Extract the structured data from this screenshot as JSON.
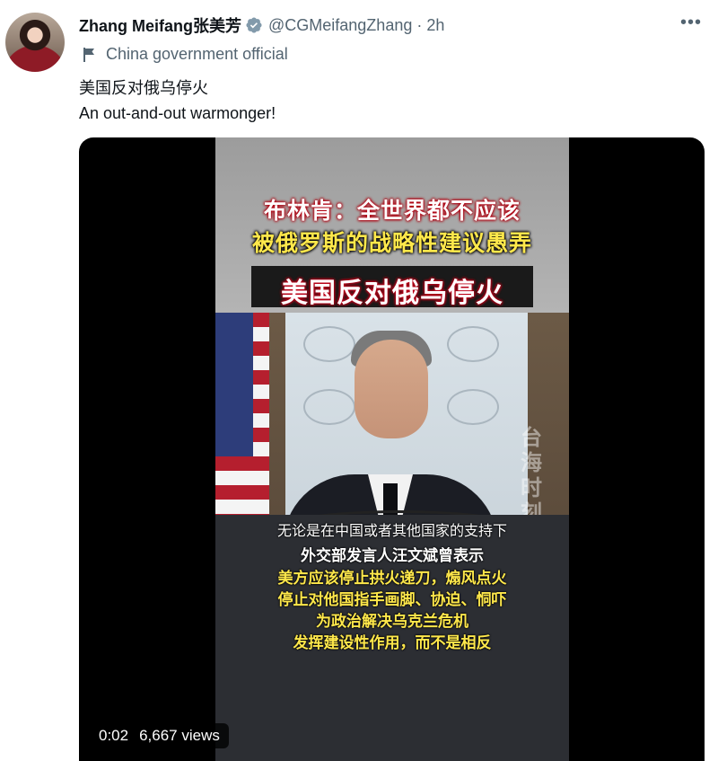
{
  "author": {
    "name": "Zhang Meifang张美芳",
    "handle": "@CGMeifangZhang",
    "separator": "·",
    "time": "2h",
    "label": "China government official"
  },
  "tweet": {
    "line1": "美国反对俄乌停火",
    "line2": "An out-and-out warmonger!"
  },
  "video": {
    "caption_top": "布林肯：全世界都不应该",
    "caption_mid": "被俄罗斯的战略性建议愚弄",
    "caption_headline": "美国反对俄乌停火",
    "watermark": "台海时刻",
    "subtitles": [
      "无论是在中国或者其他国家的支持下",
      "外交部发言人汪文斌曾表示",
      "美方应该停止拱火递刀，煽风点火",
      "停止对他国指手画脚、协迫、恫吓",
      "为政治解决乌克兰危机",
      "发挥建设性作用，而不是相反"
    ],
    "elapsed": "0:02",
    "views": "6,667 views"
  },
  "colors": {
    "verified": "#829aab",
    "caption_red": "#c00018",
    "caption_yellow": "#ffe84b"
  },
  "icons": [
    "verified-badge-icon",
    "flag-icon",
    "more-icon"
  ]
}
